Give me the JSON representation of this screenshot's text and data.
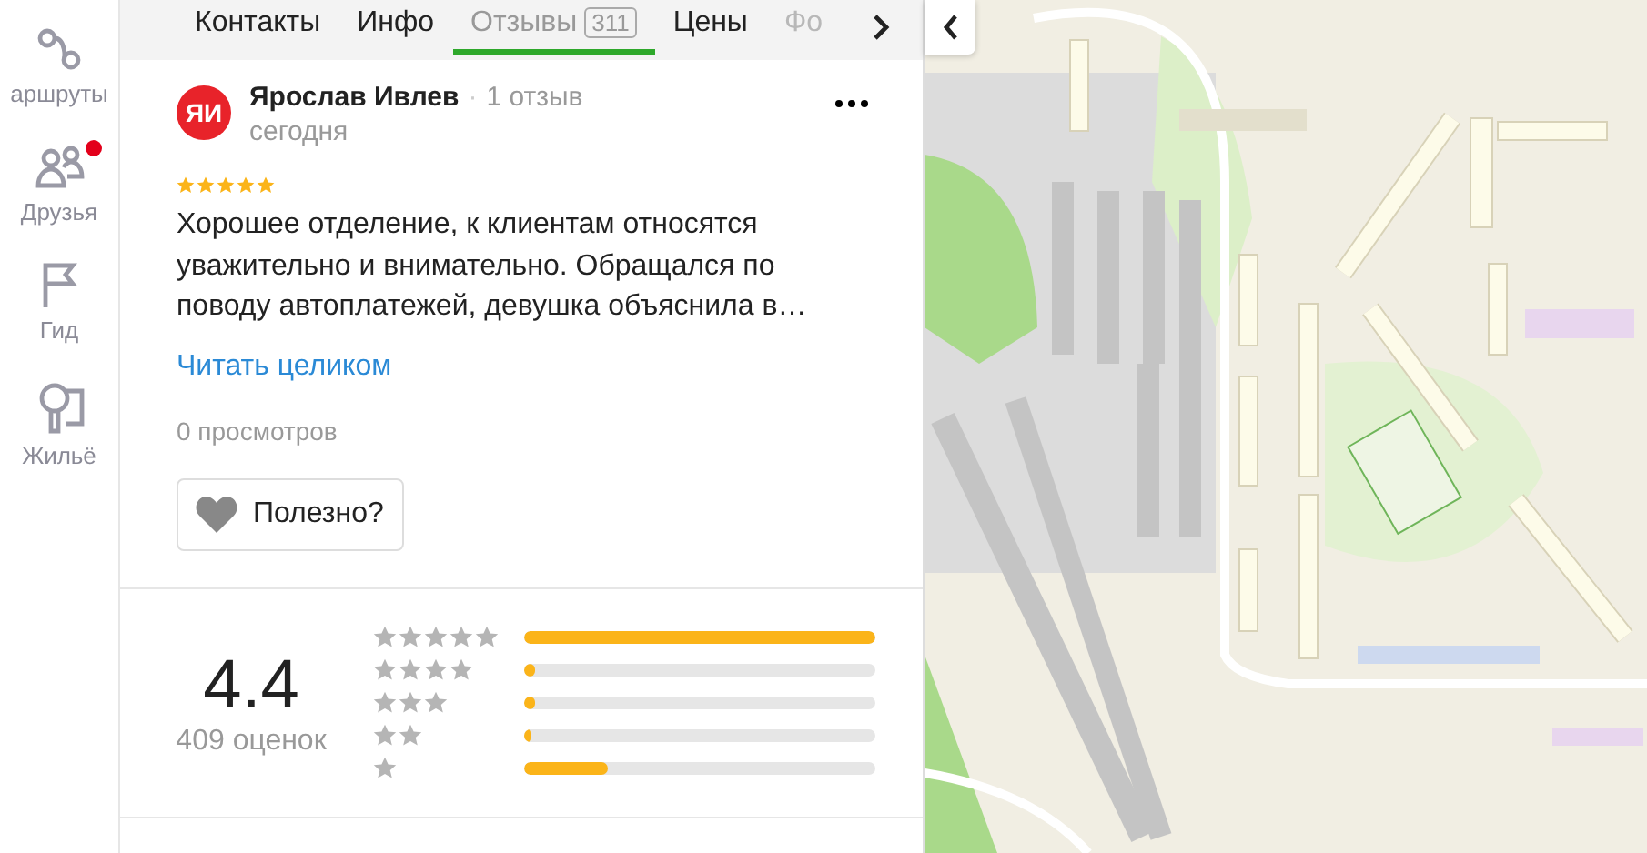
{
  "sidebar": {
    "items": [
      {
        "kind": "routes",
        "label": "аршруты",
        "notification": false
      },
      {
        "kind": "friends",
        "label": "Друзья",
        "notification": true
      },
      {
        "kind": "guide",
        "label": "Гид",
        "notification": false
      },
      {
        "kind": "housing",
        "label": "Жильё",
        "notification": false
      }
    ]
  },
  "tabs": [
    {
      "label": "Контакты",
      "selected": false,
      "faded": false
    },
    {
      "label": "Инфо",
      "selected": false,
      "faded": false
    },
    {
      "label": "Отзывы",
      "badge": "311",
      "selected": true,
      "faded": false
    },
    {
      "label": "Цены",
      "selected": false,
      "faded": false
    },
    {
      "label": "Фо",
      "selected": false,
      "faded": true
    }
  ],
  "review": {
    "avatar": "ЯИ",
    "author": "Ярослав Ивлев",
    "separator": "·",
    "reviews_count": "1 отзыв",
    "date": "сегодня",
    "stars": 5,
    "text": "Хорошее отделение, к клиентам относятся уважительно и внимательно. Обращался по поводу автоплатежей, девушка объяснила в…",
    "read_more": "Читать целиком",
    "views": "0 просмотров",
    "useful_button": "Полезно?"
  },
  "rating": {
    "score": "4.4",
    "count": "409 оценок",
    "rows": [
      {
        "level": 1.0
      },
      {
        "level": 0.03
      },
      {
        "level": 0.03
      },
      {
        "level": 0.02
      },
      {
        "level": 0.24
      }
    ]
  }
}
